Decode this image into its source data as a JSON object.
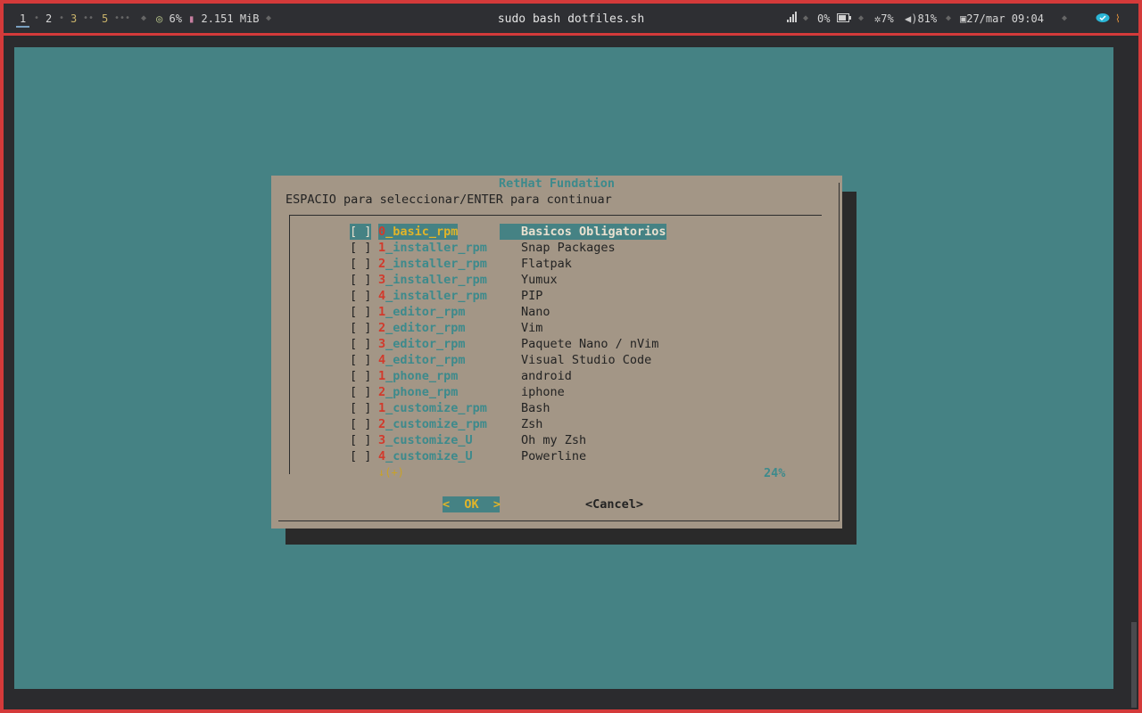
{
  "topbar": {
    "workspaces": [
      "1",
      "2",
      "3",
      "5"
    ],
    "cpu": "6%",
    "memory": "2.151 MiB",
    "title": "sudo bash dotfiles.sh",
    "network": "0%",
    "brightness": "7%",
    "volume": "81%",
    "datetime": "27/mar 09:04"
  },
  "dialog": {
    "title": "RetHat Fundation",
    "subtitle": "ESPACIO para seleccionar/ENTER para continuar",
    "items": [
      {
        "check": "[ ]",
        "num": "0",
        "tag": "_basic_rpm",
        "desc": "Basicos Obligatorios"
      },
      {
        "check": "[ ]",
        "num": "1",
        "tag": "_installer_rpm",
        "desc": "Snap Packages"
      },
      {
        "check": "[ ]",
        "num": "2",
        "tag": "_installer_rpm",
        "desc": "Flatpak"
      },
      {
        "check": "[ ]",
        "num": "3",
        "tag": "_installer_rpm",
        "desc": "Yumux"
      },
      {
        "check": "[ ]",
        "num": "4",
        "tag": "_installer_rpm",
        "desc": "PIP"
      },
      {
        "check": "[ ]",
        "num": "1",
        "tag": "_editor_rpm",
        "desc": "Nano"
      },
      {
        "check": "[ ]",
        "num": "2",
        "tag": "_editor_rpm",
        "desc": "Vim"
      },
      {
        "check": "[ ]",
        "num": "3",
        "tag": "_editor_rpm",
        "desc": "Paquete Nano / nVim"
      },
      {
        "check": "[ ]",
        "num": "4",
        "tag": "_editor_rpm",
        "desc": "Visual Studio Code"
      },
      {
        "check": "[ ]",
        "num": "1",
        "tag": "_phone_rpm",
        "desc": "android"
      },
      {
        "check": "[ ]",
        "num": "2",
        "tag": "_phone_rpm",
        "desc": "iphone"
      },
      {
        "check": "[ ]",
        "num": "1",
        "tag": "_customize_rpm",
        "desc": "Bash"
      },
      {
        "check": "[ ]",
        "num": "2",
        "tag": "_customize_rpm",
        "desc": "Zsh"
      },
      {
        "check": "[ ]",
        "num": "3",
        "tag": "_customize_U",
        "desc": "Oh my Zsh"
      },
      {
        "check": "[ ]",
        "num": "4",
        "tag": "_customize_U",
        "desc": "Powerline"
      }
    ],
    "more_indicator": "↓(+)",
    "scroll_percent": "24%",
    "ok_label": "<  OK  >",
    "cancel_label": "<Cancel>"
  }
}
